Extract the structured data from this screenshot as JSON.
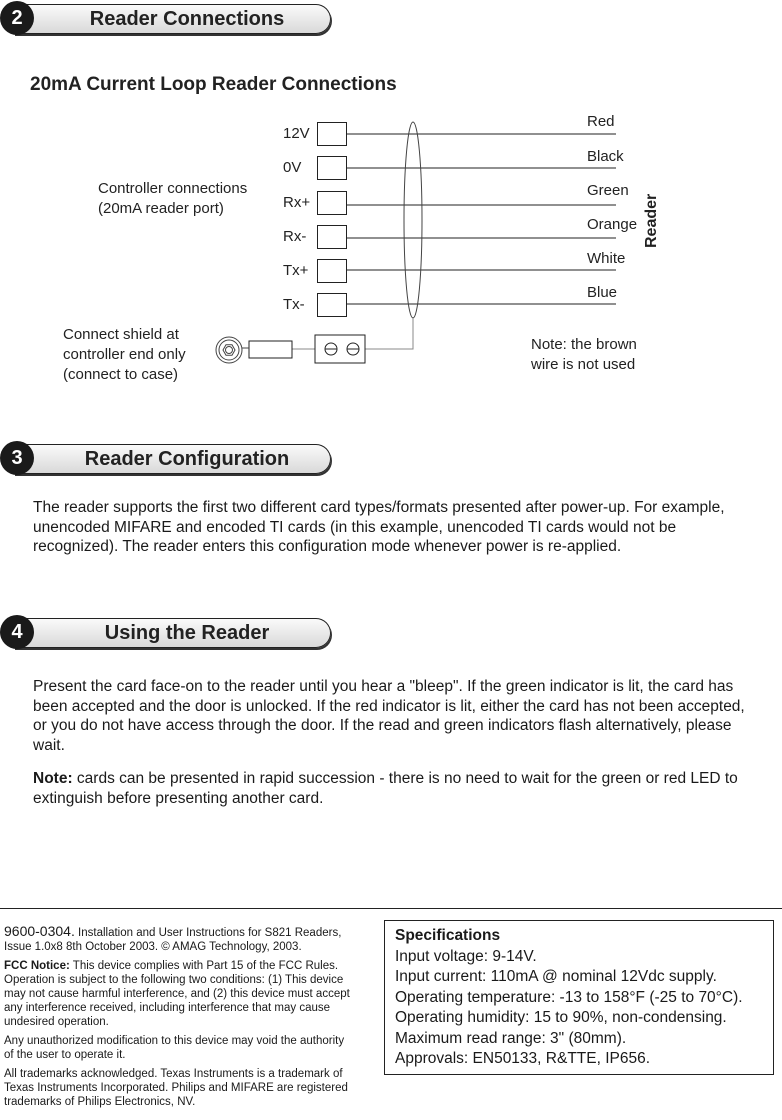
{
  "sections": [
    {
      "number": "2",
      "title": "Reader Connections"
    },
    {
      "number": "3",
      "title": "Reader Configuration"
    },
    {
      "number": "4",
      "title": "Using the Reader"
    }
  ],
  "diagram": {
    "heading": "20mA Current Loop Reader Connections",
    "controller_label_1": "Controller connections",
    "controller_label_2": "(20mA reader port)",
    "terminals": [
      "12V",
      "0V",
      "Rx+",
      "Rx-",
      "Tx+",
      "Tx-"
    ],
    "wire_colors": [
      "Red",
      "Black",
      "Green",
      "Orange",
      "White",
      "Blue"
    ],
    "reader_label": "Reader",
    "shield_note_1": "Connect shield at",
    "shield_note_2": "controller end only",
    "shield_note_3": "(connect to case)",
    "brown_note_1": "Note: the brown",
    "brown_note_2": "wire is not used"
  },
  "configuration": {
    "text": "The reader supports the first two different card types/formats presented after power-up. For example, unencoded MIFARE and encoded TI cards (in this example, unencoded TI cards would not be recognized). The reader enters this configuration mode whenever power is re-applied."
  },
  "using": {
    "text": "Present the card face-on to the reader until you hear a \"bleep\". If the green indicator is lit, the card has been accepted and the door is unlocked. If the red indicator is lit, either the card has not been accepted, or you do not have access through the door. If the read and green indicators flash alternatively, please wait.",
    "note_label": "Note:",
    "note_text": " cards can be presented in rapid succession - there is no need to wait for the green or red LED to extinguish before presenting another card."
  },
  "footer": {
    "doc_number": "9600-0304.",
    "doc_desc": " Installation and User Instructions for S821 Readers, Issue 1.0x8 8th October 2003. © AMAG Technology, 2003.",
    "fcc_label": "FCC Notice:",
    "fcc_text": " This device complies with Part 15 of the FCC Rules. Operation is subject to the following two conditions: (1) This device may not cause harmful interference, and (2) this device must accept any interference received, including interference that may cause undesired operation.",
    "modification": "Any unauthorized modification to this device may void the authority of the user to operate it.",
    "trademarks": "All trademarks acknowledged. Texas Instruments is a trademark of Texas Instruments Incorporated. Philips and MIFARE are registered trademarks of Philips Electronics, NV."
  },
  "specifications": {
    "title": "Specifications",
    "lines": [
      "Input voltage: 9-14V.",
      "Input current: 110mA @ nominal 12Vdc supply.",
      "Operating temperature: -13 to 158°F (-25 to 70°C).",
      "Operating humidity: 15 to 90%, non-condensing.",
      "Maximum read range: 3\" (80mm).",
      "Approvals: EN50133, R&TTE, IP656."
    ]
  }
}
